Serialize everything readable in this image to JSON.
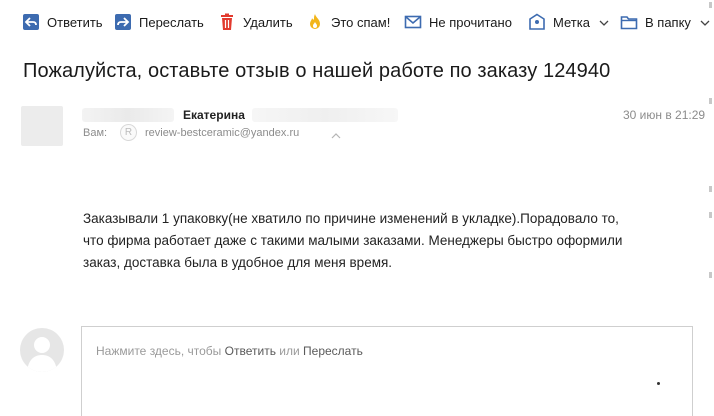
{
  "toolbar": {
    "reply": "Ответить",
    "forward": "Переслать",
    "delete": "Удалить",
    "spam": "Это спам!",
    "unread": "Не прочитано",
    "label": "Метка",
    "folder": "В папку"
  },
  "colors": {
    "icon_blue": "#3d6bb0",
    "delete_red": "#e23a2e",
    "spam_yellow": "#f2b51a"
  },
  "message": {
    "subject": "Пожалуйста, оставьте отзыв о нашей работе по заказу 124940",
    "sender_name": "Екатерина",
    "date": "30 июн в 21:29",
    "to_label": "Вам:",
    "to_badge": "R",
    "to_email": "review-bestceramic@yandex.ru",
    "body_lines": [
      "Заказывали 1 упаковку(не хватило по причине изменений в укладке).Порадовало то,",
      "что фирма работает даже с такими малыми заказами. Менеджеры быстро оформили",
      "заказ, доставка была в удобное для меня время."
    ]
  },
  "reply": {
    "prompt_prefix": "Нажмите здесь, чтобы ",
    "reply_link": "Ответить",
    "or": " или ",
    "forward_link": "Переслать"
  }
}
